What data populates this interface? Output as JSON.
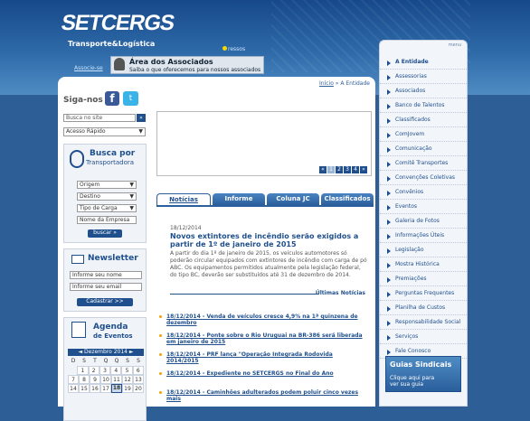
{
  "header": {
    "logo": "SETCERGS",
    "tagline": "Transporte&Logística",
    "ingressos": "ressos",
    "associe": "Associe-se",
    "area_title": "Área dos Associados",
    "area_sub": "Saiba o que oferecemos para nossos associados"
  },
  "breadcrumb": {
    "home": "Início",
    "sep": " » ",
    "current": "A Entidade"
  },
  "left": {
    "siga": "Siga-nos",
    "fb": "f",
    "tw": "t",
    "search_placeholder": "Busca no site",
    "search_btn": "»",
    "quick_access": "Acesso Rápido",
    "arrow": "▼",
    "transp": {
      "title": "Busca por",
      "title2": "Transportadora",
      "origem": "Origem",
      "destino": "Destino",
      "tipo": "Tipo de Carga",
      "empresa": "Nome da Empresa",
      "btn": "buscar »"
    },
    "newsletter": {
      "title": "Newsletter",
      "name": "Informe seu nome",
      "email": "Informe seu email",
      "btn": "Cadastrar >>"
    },
    "agenda": {
      "title": "Agenda",
      "title2": "de Eventos",
      "month": "Dezembro 2014",
      "prev": "◄",
      "next": "►",
      "weekdays": [
        "D",
        "S",
        "T",
        "Q",
        "Q",
        "S",
        "S"
      ],
      "rows": [
        [
          "",
          "1",
          "2",
          "3",
          "4",
          "5",
          "6"
        ],
        [
          "7",
          "8",
          "9",
          "10",
          "11",
          "12",
          "13"
        ],
        [
          "14",
          "15",
          "16",
          "17",
          "18",
          "19",
          "20"
        ]
      ],
      "selected": "18"
    }
  },
  "banner": {
    "pages": [
      "«",
      "1",
      "2",
      "3",
      "4",
      "»"
    ],
    "active": "1"
  },
  "tabs": [
    "Notícias",
    "Informe",
    "Coluna JC",
    "Classificados"
  ],
  "news": {
    "date": "18/12/2014",
    "title": "Novos extintores de incêndio serão exigidos a partir de 1º de janeiro de 2015",
    "text": "A partir do dia 1º de janeiro de 2015, os veículos automotores só poderão circular equipados com extintores de incêndio com carga de pó ABC. Os equipamentos permitidos atualmente pela legislação federal, do tipo BC, deverão ser substituídos até 31 de dezembro de 2014."
  },
  "ultimas": "Últimas Notícias",
  "items": [
    "18/12/2014 - Venda de veículos cresce 4,9% na 1ª quinzena de dezembro",
    "18/12/2014 - Ponte sobre o Rio Uruguai na BR-386 será liberada em janeiro de 2015",
    "18/12/2014 - PRF lança \"Operação Integrada Rodovida 2014/2015",
    "18/12/2014 - Expediente no SETCERGS no Final do Ano",
    "18/12/2014 - Caminhões adulterados podem poluir cinco vezes mais"
  ],
  "menu_label": "menu",
  "menu": [
    "A Entidade",
    "Assessorias",
    "Associados",
    "Banco de Talentos",
    "Classificados",
    "ComJovem",
    "Comunicação",
    "Comitê Transportes",
    "Convenções Coletivas",
    "Convênios",
    "Eventos",
    "Galeria de Fotos",
    "Informações Úteis",
    "Legislação",
    "Mostra Histórica",
    "Premiações",
    "Perguntas Frequentes",
    "Planilha de Custos",
    "Responsabilidade Social",
    "Serviços",
    "Fale Conosco"
  ],
  "guias": {
    "title": "Guias Sindicais",
    "sub1": "Clique aqui para",
    "sub2": "ver sua guia"
  }
}
